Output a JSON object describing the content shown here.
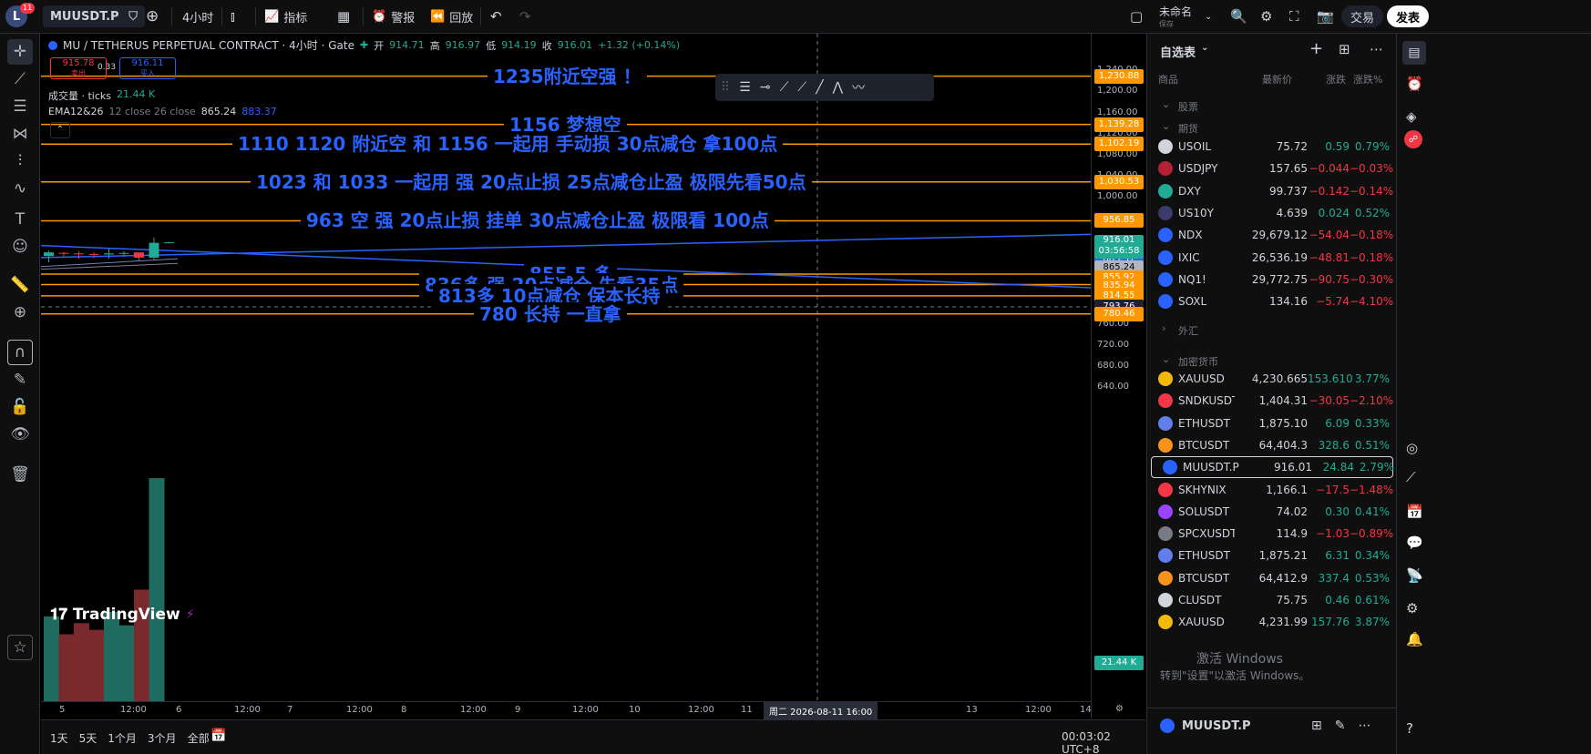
{
  "topbar": {
    "avatar_letter": "L",
    "notif_count": "11",
    "symbol": "MUUSDT.P",
    "interval": "4小时",
    "indicators_label": "指标",
    "alert_label": "警报",
    "replay_label": "回放",
    "layout_name": "未命名",
    "layout_status": "保存",
    "trade_label": "交易",
    "publish_label": "发表"
  },
  "legend": {
    "title": "MU / TETHERUS PERPETUAL CONTRACT · 4小时 · Gate",
    "open_label": "开",
    "open": "914.71",
    "high_label": "高",
    "high": "916.97",
    "low_label": "低",
    "low": "914.19",
    "close_label": "收",
    "close": "916.01",
    "change": "+1.32 (+0.14%)",
    "sell_price": "915.78",
    "sell_label": "卖出",
    "spread": "0.33",
    "buy_price": "916.11",
    "buy_label": "买入",
    "volume_label": "成交量 · ticks",
    "volume_value": "21.44 K",
    "ema_label": "EMA12&26",
    "ema_params": "12 close 26 close",
    "ema1": "865.24",
    "ema2": "883.37"
  },
  "annotations": [
    {
      "price": 1230.88,
      "text": "1235附近空强  ！"
    },
    {
      "price": 1139.28,
      "text": "1156 梦想空"
    },
    {
      "price": 1102.19,
      "text": "1110     1120 附近空       和 1156 一起用    手动损       30点减仓 拿100点"
    },
    {
      "price": 1030.53,
      "text": "1023 和 1033 一起用    强  20点止损    25点减仓止盈  极限先看50点"
    },
    {
      "price": 956.85,
      "text": "963 空 强    20点止损 挂单  30点减仓止盈  极限看 100点"
    },
    {
      "price": 855.92,
      "text": "855.5 多"
    },
    {
      "price": 835.94,
      "text": "836多  强  20点减仓  先看35点"
    },
    {
      "price": 814.55,
      "text": "813多     10点减仓 保本长持"
    },
    {
      "price": 780.46,
      "text": "780  长持  一直拿"
    }
  ],
  "price_axis": {
    "ticks": [
      "1,240.00",
      "1,200.00",
      "1,160.00",
      "1,120.00",
      "1,080.00",
      "1,040.00",
      "1,000.00",
      "760.00",
      "720.00",
      "680.00",
      "640.00"
    ],
    "labels": [
      {
        "text": "1,230.88",
        "bg": "#ff9800"
      },
      {
        "text": "1,139.28",
        "bg": "#ff9800"
      },
      {
        "text": "1,102.19",
        "bg": "#ff9800"
      },
      {
        "text": "1,030.53",
        "bg": "#ff9800"
      },
      {
        "text": "956.85",
        "bg": "#ff9800"
      },
      {
        "text": "883.37",
        "bg": "#2962ff"
      },
      {
        "text": "865.24",
        "bg": "#b2b5be"
      },
      {
        "text": "855.92",
        "bg": "#ff9800"
      },
      {
        "text": "835.94",
        "bg": "#ff9800"
      },
      {
        "text": "814.55",
        "bg": "#ff9800"
      },
      {
        "text": "793.76",
        "bg": "#1e222d"
      },
      {
        "text": "780.46",
        "bg": "#ff9800"
      },
      {
        "text": "21.44 K",
        "bg": "#22ab94"
      }
    ],
    "current_price": "916.01",
    "countdown": "03:56:58"
  },
  "time_axis": {
    "labels": [
      "5",
      "12:00",
      "6",
      "12:00",
      "7",
      "12:00",
      "8",
      "12:00",
      "9",
      "12:00",
      "10",
      "12:00",
      "11",
      "12:00",
      "13",
      "12:00",
      "14"
    ],
    "crosshair": "周二 2026-08-11   16:00"
  },
  "bottombar": {
    "ranges": [
      "1天",
      "5天",
      "1个月",
      "3个月",
      "全部"
    ],
    "clock": "00:03:02 UTC+8"
  },
  "watchlist": {
    "title": "自选表",
    "cols": [
      "商品",
      "最新价",
      "涨跌",
      "涨跌%"
    ],
    "sections": [
      "股票",
      "期货",
      "外汇",
      "加密货币"
    ],
    "rows": [
      {
        "sym": "USOIL",
        "last": "75.72",
        "chg": "0.59",
        "pct": "0.79%",
        "dir": "up",
        "icon": "#d1d4dc"
      },
      {
        "sym": "USDJPY",
        "last": "157.65",
        "chg": "−0.044",
        "pct": "−0.03%",
        "dir": "dn",
        "icon": "#b22234"
      },
      {
        "sym": "DXY",
        "last": "99.737",
        "chg": "−0.142",
        "pct": "−0.14%",
        "dir": "dn",
        "icon": "#22ab94"
      },
      {
        "sym": "US10Y",
        "last": "4.639",
        "chg": "0.024",
        "pct": "0.52%",
        "dir": "up",
        "icon": "#3c3b6e"
      },
      {
        "sym": "NDX",
        "last": "29,679.12",
        "chg": "−54.04",
        "pct": "−0.18%",
        "dir": "dn",
        "icon": "#2962ff"
      },
      {
        "sym": "IXIC",
        "last": "26,536.19",
        "chg": "−48.81",
        "pct": "−0.18%",
        "dir": "dn",
        "icon": "#2962ff"
      },
      {
        "sym": "NQ1!",
        "last": "29,772.75",
        "chg": "−90.75",
        "pct": "−0.30%",
        "dir": "dn",
        "icon": "#2962ff"
      },
      {
        "sym": "SOXL",
        "last": "134.16",
        "chg": "−5.74",
        "pct": "−4.10%",
        "dir": "dn",
        "icon": "#2962ff"
      },
      {
        "sym": "XAUUSD",
        "last": "4,230.665",
        "chg": "153.610",
        "pct": "3.77%",
        "dir": "up",
        "icon": "#f0b90b"
      },
      {
        "sym": "SNDKUSDT",
        "last": "1,404.31",
        "chg": "−30.05",
        "pct": "−2.10%",
        "dir": "dn",
        "icon": "#f23645"
      },
      {
        "sym": "ETHUSDT",
        "last": "1,875.10",
        "chg": "6.09",
        "pct": "0.33%",
        "dir": "up",
        "icon": "#627eea"
      },
      {
        "sym": "BTCUSDT",
        "last": "64,404.3",
        "chg": "328.6",
        "pct": "0.51%",
        "dir": "up",
        "icon": "#f7931a"
      },
      {
        "sym": "MUUSDT.P",
        "last": "916.01",
        "chg": "24.84",
        "pct": "2.79%",
        "dir": "up",
        "icon": "#2962ff"
      },
      {
        "sym": "SKHYNIX",
        "last": "1,166.1",
        "chg": "−17.5",
        "pct": "−1.48%",
        "dir": "dn",
        "icon": "#f23645"
      },
      {
        "sym": "SOLUSDT",
        "last": "74.02",
        "chg": "0.30",
        "pct": "0.41%",
        "dir": "up",
        "icon": "#9945ff"
      },
      {
        "sym": "SPCXUSDT",
        "last": "114.9",
        "chg": "−1.03",
        "pct": "−0.89%",
        "dir": "dn",
        "icon": "#787b86"
      },
      {
        "sym": "ETHUSDT",
        "last": "1,875.21",
        "chg": "6.31",
        "pct": "0.34%",
        "dir": "up",
        "icon": "#627eea"
      },
      {
        "sym": "BTCUSDT",
        "last": "64,412.9",
        "chg": "337.4",
        "pct": "0.53%",
        "dir": "up",
        "icon": "#f7931a"
      },
      {
        "sym": "CLUSDT",
        "last": "75.75",
        "chg": "0.46",
        "pct": "0.61%",
        "dir": "up",
        "icon": "#d1d4dc"
      },
      {
        "sym": "XAUUSD",
        "last": "4,231.99",
        "chg": "157.76",
        "pct": "3.87%",
        "dir": "up",
        "icon": "#f0b90b"
      }
    ],
    "footer_symbol": "MUUSDT.P"
  },
  "watermark": {
    "line1": "激活 Windows",
    "line2": "转到\"设置\"以激活 Windows。"
  },
  "logo": "TradingView",
  "candles": [
    {
      "o": 890,
      "h": 900,
      "l": 878,
      "c": 897
    },
    {
      "o": 896,
      "h": 898,
      "l": 888,
      "c": 895
    },
    {
      "o": 895,
      "h": 899,
      "l": 885,
      "c": 894
    },
    {
      "o": 894,
      "h": 897,
      "l": 886,
      "c": 893
    },
    {
      "o": 893,
      "h": 905,
      "l": 885,
      "c": 895
    },
    {
      "o": 895,
      "h": 899,
      "l": 889,
      "c": 896
    },
    {
      "o": 897,
      "h": 896,
      "l": 882,
      "c": 887
    },
    {
      "o": 887,
      "h": 925,
      "l": 883,
      "c": 915
    },
    {
      "o": 914.71,
      "h": 916.97,
      "l": 914.19,
      "c": 916.01
    }
  ],
  "volumes": [
    38,
    30,
    35,
    32,
    40,
    34,
    50,
    100,
    0
  ]
}
